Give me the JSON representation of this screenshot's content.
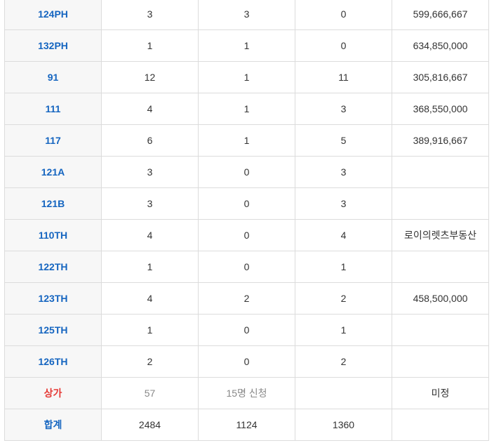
{
  "colors": {
    "type_text": "#1565c0",
    "shop_text": "#e53935",
    "muted_text": "#888888",
    "border": "#dcdcdc",
    "type_bg": "#f7f7f7"
  },
  "rows": [
    {
      "type": "124PH",
      "c1": "3",
      "c2": "3",
      "c3": "0",
      "price": "599,666,667"
    },
    {
      "type": "132PH",
      "c1": "1",
      "c2": "1",
      "c3": "0",
      "price": "634,850,000"
    },
    {
      "type": "91",
      "c1": "12",
      "c2": "1",
      "c3": "11",
      "price": "305,816,667"
    },
    {
      "type": "111",
      "c1": "4",
      "c2": "1",
      "c3": "3",
      "price": "368,550,000"
    },
    {
      "type": "117",
      "c1": "6",
      "c2": "1",
      "c3": "5",
      "price": "389,916,667"
    },
    {
      "type": "121A",
      "c1": "3",
      "c2": "0",
      "c3": "3",
      "price": ""
    },
    {
      "type": "121B",
      "c1": "3",
      "c2": "0",
      "c3": "3",
      "price": ""
    },
    {
      "type": "110TH",
      "c1": "4",
      "c2": "0",
      "c3": "4",
      "price": "로이의렛츠부동산"
    },
    {
      "type": "122TH",
      "c1": "1",
      "c2": "0",
      "c3": "1",
      "price": ""
    },
    {
      "type": "123TH",
      "c1": "4",
      "c2": "2",
      "c3": "2",
      "price": "458,500,000"
    },
    {
      "type": "125TH",
      "c1": "1",
      "c2": "0",
      "c3": "1",
      "price": ""
    },
    {
      "type": "126TH",
      "c1": "2",
      "c2": "0",
      "c3": "2",
      "price": ""
    }
  ],
  "shop": {
    "type": "상가",
    "c1": "57",
    "c2": "15명 신청",
    "c3": "",
    "price": "미정"
  },
  "total": {
    "type": "합계",
    "c1": "2484",
    "c2": "1124",
    "c3": "1360",
    "price": ""
  }
}
